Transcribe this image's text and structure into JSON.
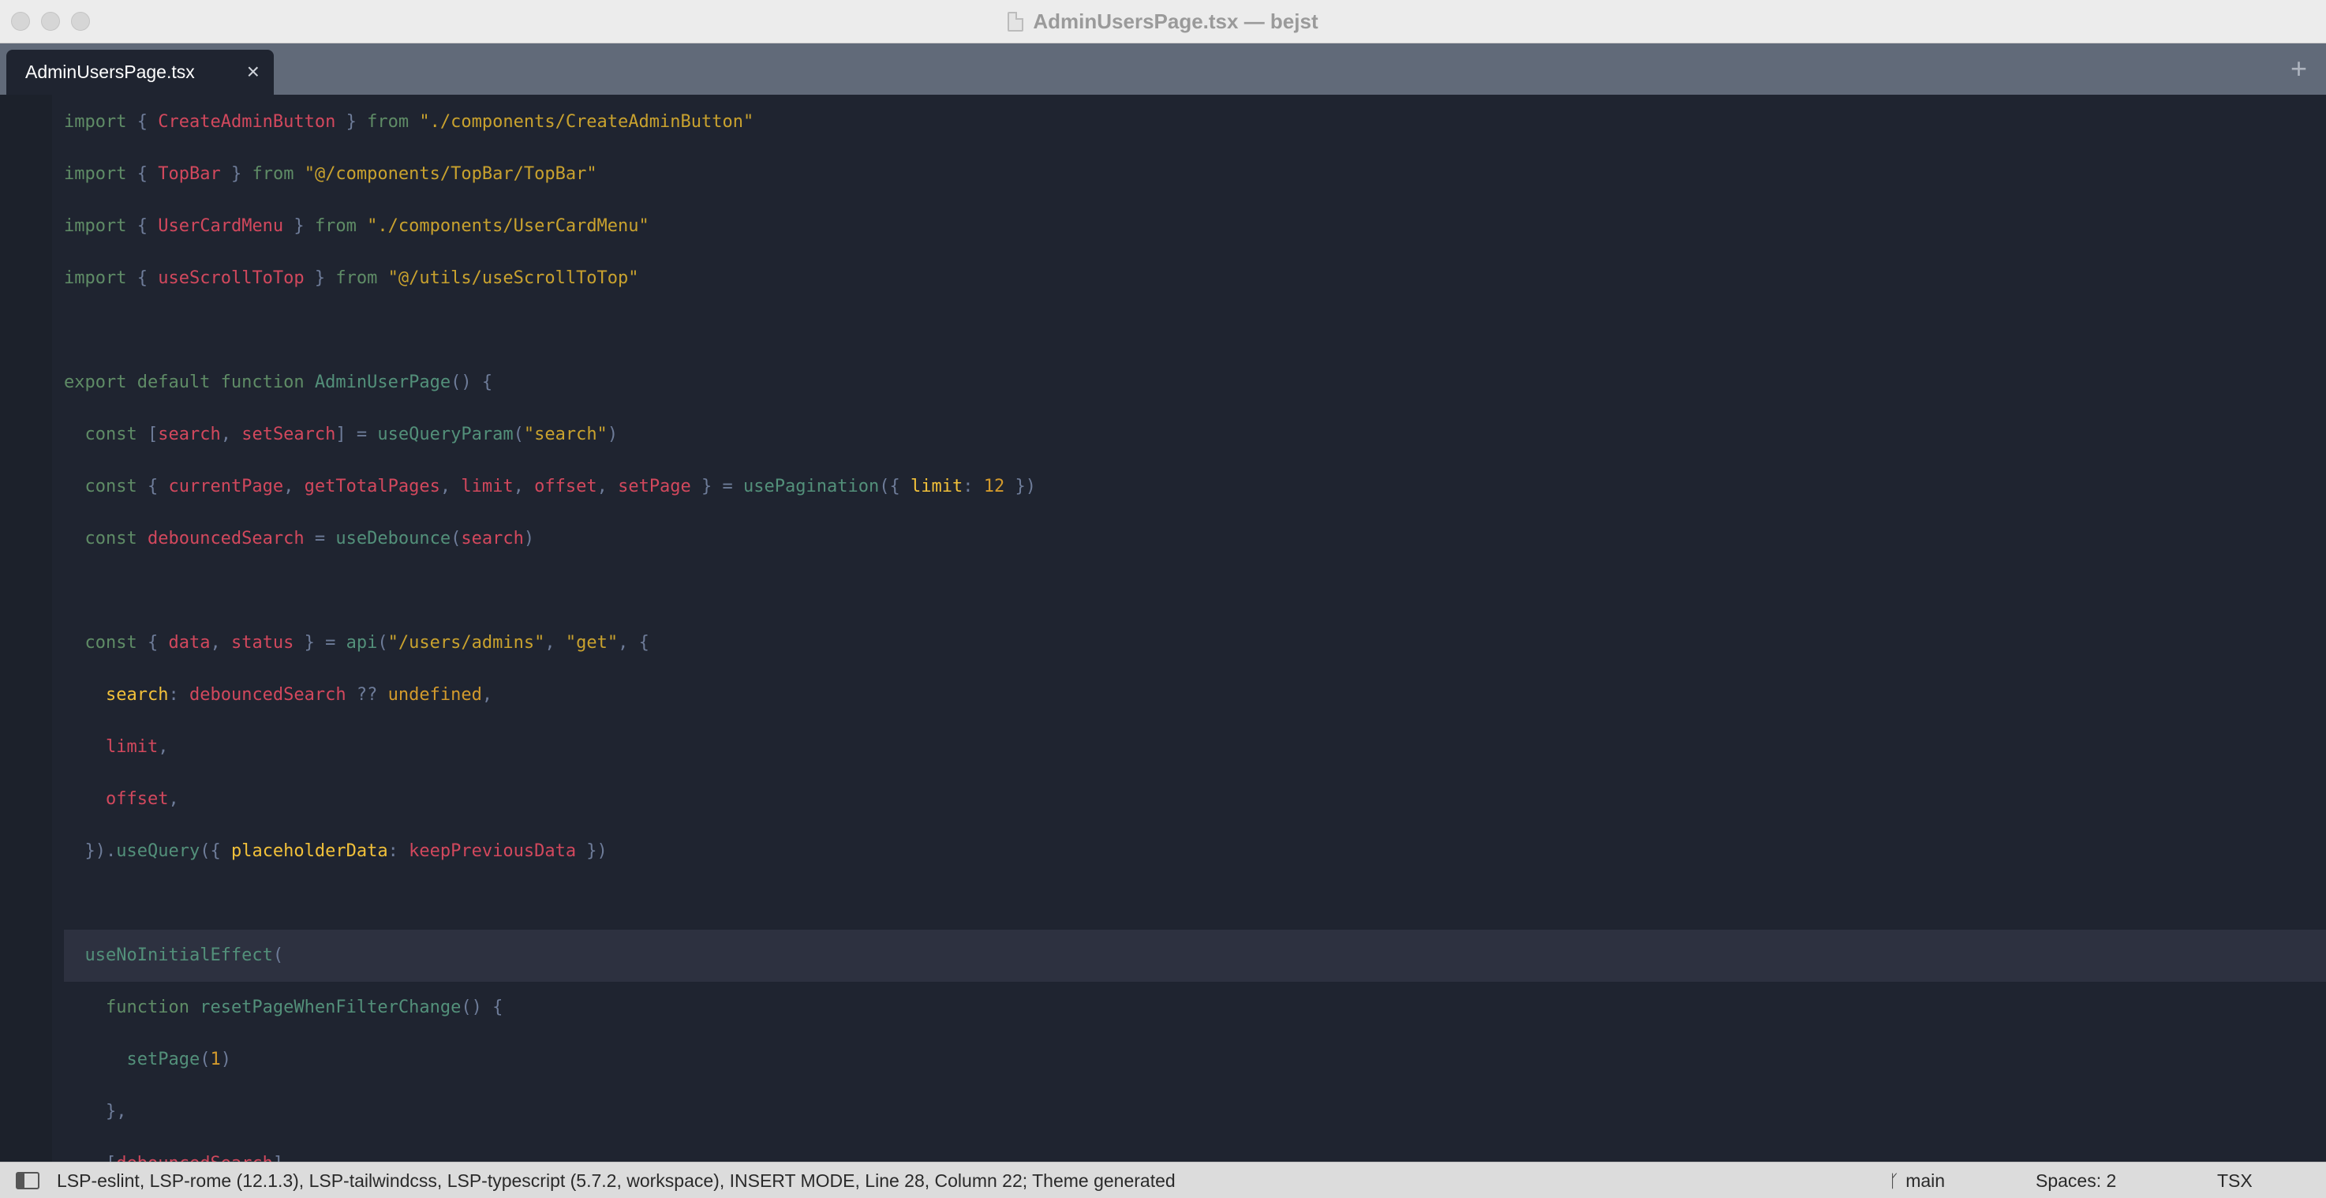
{
  "window": {
    "title": "AdminUsersPage.tsx — bejst"
  },
  "tabs": [
    {
      "label": "AdminUsersPage.tsx",
      "close": "×",
      "active": true
    }
  ],
  "tabbar": {
    "new_tab": "+"
  },
  "editor": {
    "current_line": 17,
    "lines": [
      [
        [
          "import",
          "k"
        ],
        [
          " { ",
          "p"
        ],
        [
          "CreateAdminButton",
          "i"
        ],
        [
          " } ",
          "p"
        ],
        [
          "from",
          "k"
        ],
        [
          " \"./components/CreateAdminButton\"",
          "s"
        ]
      ],
      [
        [
          "import",
          "k"
        ],
        [
          " { ",
          "p"
        ],
        [
          "TopBar",
          "i"
        ],
        [
          " } ",
          "p"
        ],
        [
          "from",
          "k"
        ],
        [
          " \"@/components/TopBar/TopBar\"",
          "s"
        ]
      ],
      [
        [
          "import",
          "k"
        ],
        [
          " { ",
          "p"
        ],
        [
          "UserCardMenu",
          "i"
        ],
        [
          " } ",
          "p"
        ],
        [
          "from",
          "k"
        ],
        [
          " \"./components/UserCardMenu\"",
          "s"
        ]
      ],
      [
        [
          "import",
          "k"
        ],
        [
          " { ",
          "p"
        ],
        [
          "useScrollToTop",
          "i"
        ],
        [
          " } ",
          "p"
        ],
        [
          "from",
          "k"
        ],
        [
          " \"@/utils/useScrollToTop\"",
          "s"
        ]
      ],
      [],
      [
        [
          "export default function ",
          "k"
        ],
        [
          "AdminUserPage",
          "f"
        ],
        [
          "() {",
          "p"
        ]
      ],
      [
        [
          "  const ",
          "k"
        ],
        [
          "[",
          "p"
        ],
        [
          "search",
          "i"
        ],
        [
          ", ",
          "p"
        ],
        [
          "setSearch",
          "i"
        ],
        [
          "] = ",
          "p"
        ],
        [
          "useQueryParam",
          "f"
        ],
        [
          "(",
          "p"
        ],
        [
          "\"search\"",
          "s"
        ],
        [
          ")",
          "p"
        ]
      ],
      [
        [
          "  const ",
          "k"
        ],
        [
          "{ ",
          "p"
        ],
        [
          "currentPage",
          "i"
        ],
        [
          ", ",
          "p"
        ],
        [
          "getTotalPages",
          "i"
        ],
        [
          ", ",
          "p"
        ],
        [
          "limit",
          "i"
        ],
        [
          ", ",
          "p"
        ],
        [
          "offset",
          "i"
        ],
        [
          ", ",
          "p"
        ],
        [
          "setPage",
          "i"
        ],
        [
          " } = ",
          "p"
        ],
        [
          "usePagination",
          "f"
        ],
        [
          "({ ",
          "p"
        ],
        [
          "limit",
          "y"
        ],
        [
          ": ",
          "p"
        ],
        [
          "12",
          "n"
        ],
        [
          " })",
          "p"
        ]
      ],
      [
        [
          "  const ",
          "k"
        ],
        [
          "debouncedSearch",
          "i"
        ],
        [
          " = ",
          "p"
        ],
        [
          "useDebounce",
          "f"
        ],
        [
          "(",
          "p"
        ],
        [
          "search",
          "i"
        ],
        [
          ")",
          "p"
        ]
      ],
      [],
      [
        [
          "  const ",
          "k"
        ],
        [
          "{ ",
          "p"
        ],
        [
          "data",
          "i"
        ],
        [
          ", ",
          "p"
        ],
        [
          "status",
          "i"
        ],
        [
          " } = ",
          "p"
        ],
        [
          "api",
          "f"
        ],
        [
          "(",
          "p"
        ],
        [
          "\"/users/admins\"",
          "s"
        ],
        [
          ", ",
          "p"
        ],
        [
          "\"get\"",
          "s"
        ],
        [
          ", {",
          "p"
        ]
      ],
      [
        [
          "    ",
          "p"
        ],
        [
          "search",
          "y"
        ],
        [
          ": ",
          "p"
        ],
        [
          "debouncedSearch",
          "i"
        ],
        [
          " ?? ",
          "p"
        ],
        [
          "undefined",
          "n"
        ],
        [
          ",",
          "p"
        ]
      ],
      [
        [
          "    ",
          "p"
        ],
        [
          "limit",
          "i"
        ],
        [
          ",",
          "p"
        ]
      ],
      [
        [
          "    ",
          "p"
        ],
        [
          "offset",
          "i"
        ],
        [
          ",",
          "p"
        ]
      ],
      [
        [
          "  }).",
          "p"
        ],
        [
          "useQuery",
          "f"
        ],
        [
          "({ ",
          "p"
        ],
        [
          "placeholderData",
          "y"
        ],
        [
          ": ",
          "p"
        ],
        [
          "keepPreviousData",
          "i"
        ],
        [
          " })",
          "p"
        ]
      ],
      [],
      [
        [
          "  ",
          "p"
        ],
        [
          "useNoInitialEffect",
          "f"
        ],
        [
          "(",
          "p"
        ]
      ],
      [
        [
          "    ",
          "p"
        ],
        [
          "function ",
          "k"
        ],
        [
          "resetPageWhenFilterChange",
          "f"
        ],
        [
          "() {",
          "p"
        ]
      ],
      [
        [
          "      ",
          "p"
        ],
        [
          "setPage",
          "f"
        ],
        [
          "(",
          "p"
        ],
        [
          "1",
          "n"
        ],
        [
          ")",
          "p"
        ]
      ],
      [
        [
          "    },",
          "p"
        ]
      ],
      [
        [
          "    [",
          "p"
        ],
        [
          "debouncedSearch",
          "i"
        ],
        [
          "],",
          "p"
        ]
      ]
    ]
  },
  "statusbar": {
    "left": "LSP-eslint, LSP-rome (12.1.3), LSP-tailwindcss, LSP-typescript (5.7.2, workspace), INSERT MODE, Line 28, Column 22; Theme generated",
    "branch": "main",
    "spaces": "Spaces: 2",
    "syntax": "TSX"
  }
}
